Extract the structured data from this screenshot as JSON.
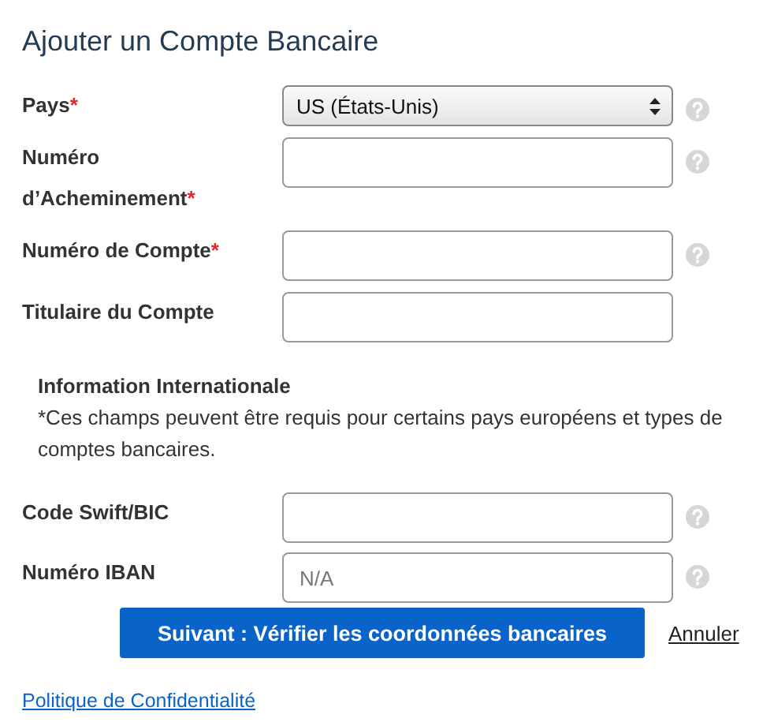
{
  "title": "Ajouter un Compte Bancaire",
  "fields": [
    {
      "kind": "select",
      "label": "Pays",
      "required_mark": "*",
      "value": "US (États-Unis)",
      "help": true
    },
    {
      "kind": "input",
      "label": "Numéro d’Acheminement",
      "required_mark": "*",
      "help": true
    },
    {
      "kind": "input",
      "label": "Numéro de Compte",
      "required_mark": "*",
      "help": true
    },
    {
      "kind": "input",
      "label": "Titulaire du Compte",
      "help": false
    }
  ],
  "international": {
    "heading": "Information Internationale",
    "note": "*Ces champs peuvent être requis pour certains pays européens et types de comptes bancaires.",
    "fields": [
      {
        "kind": "input",
        "label": "Code Swift/BIC",
        "help": true
      },
      {
        "kind": "input",
        "label": "Numéro IBAN",
        "placeholder": "N/A",
        "help": true
      }
    ]
  },
  "submit_button": "Suivant : Vérifier les coordonnées bancaires",
  "cancel_link": "Annuler",
  "privacy_link": "Politique de Confidentialité"
}
